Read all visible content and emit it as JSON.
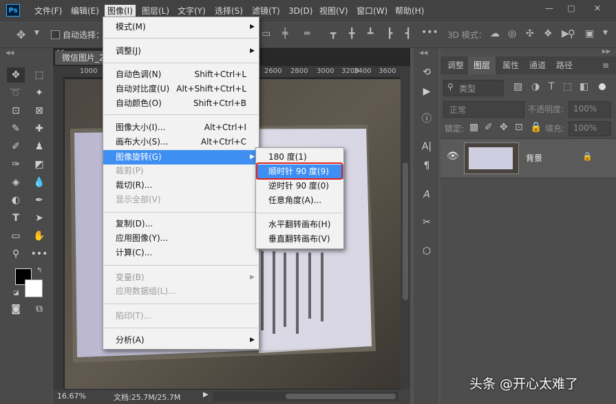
{
  "app": {
    "logo": "Ps"
  },
  "menubar": {
    "items": [
      "文件(F)",
      "编辑(E)",
      "图像(I)",
      "图层(L)",
      "文字(Y)",
      "选择(S)",
      "滤镜(T)",
      "3D(D)",
      "视图(V)",
      "窗口(W)",
      "帮助(H)"
    ],
    "active": "图像(I)",
    "window_controls": [
      "minimize-icon",
      "maximize-icon",
      "close-icon"
    ]
  },
  "options_bar": {
    "auto_select_label": "自动选择：",
    "mode3d_label": "3D 模式："
  },
  "document": {
    "tab_title": "微信图片_2",
    "ruler_ticks": [
      "1000",
      "2600",
      "2800",
      "3000",
      "3200",
      "3400",
      "3600"
    ],
    "zoom": "16.67%",
    "doc_size": "文档:25.7M/25.7M"
  },
  "panels": {
    "tabs": [
      "调整",
      "图层",
      "属性",
      "通道",
      "路径"
    ],
    "active_tab": "图层",
    "filter_label": "类型",
    "blend_mode": "正常",
    "opacity_label": "不透明度:",
    "opacity_value": "100%",
    "lock_label": "锁定:",
    "fill_label": "填充:",
    "fill_value": "100%",
    "layers": [
      {
        "name": "背景",
        "visible": true,
        "locked": true
      }
    ]
  },
  "image_menu": {
    "items": [
      {
        "label": "模式(M)",
        "shortcut": "",
        "submenu": true,
        "disabled": false
      },
      {
        "label": "调整(J)",
        "shortcut": "",
        "submenu": true,
        "disabled": false
      },
      {
        "label": "自动色调(N)",
        "shortcut": "Shift+Ctrl+L",
        "submenu": false,
        "disabled": false
      },
      {
        "label": "自动对比度(U)",
        "shortcut": "Alt+Shift+Ctrl+L",
        "submenu": false,
        "disabled": false
      },
      {
        "label": "自动颜色(O)",
        "shortcut": "Shift+Ctrl+B",
        "submenu": false,
        "disabled": false
      },
      {
        "label": "图像大小(I)...",
        "shortcut": "Alt+Ctrl+I",
        "submenu": false,
        "disabled": false
      },
      {
        "label": "画布大小(S)...",
        "shortcut": "Alt+Ctrl+C",
        "submenu": false,
        "disabled": false
      },
      {
        "label": "图像旋转(G)",
        "shortcut": "",
        "submenu": true,
        "disabled": false,
        "highlighted": true
      },
      {
        "label": "裁剪(P)",
        "shortcut": "",
        "submenu": false,
        "disabled": true
      },
      {
        "label": "裁切(R)...",
        "shortcut": "",
        "submenu": false,
        "disabled": false
      },
      {
        "label": "显示全部(V)",
        "shortcut": "",
        "submenu": false,
        "disabled": true
      },
      {
        "label": "复制(D)...",
        "shortcut": "",
        "submenu": false,
        "disabled": false
      },
      {
        "label": "应用图像(Y)...",
        "shortcut": "",
        "submenu": false,
        "disabled": false
      },
      {
        "label": "计算(C)...",
        "shortcut": "",
        "submenu": false,
        "disabled": false
      },
      {
        "label": "变量(B)",
        "shortcut": "",
        "submenu": true,
        "disabled": true
      },
      {
        "label": "应用数据组(L)...",
        "shortcut": "",
        "submenu": false,
        "disabled": true
      },
      {
        "label": "陷印(T)...",
        "shortcut": "",
        "submenu": false,
        "disabled": true
      },
      {
        "label": "分析(A)",
        "shortcut": "",
        "submenu": true,
        "disabled": false
      }
    ]
  },
  "rotate_submenu": {
    "items": [
      {
        "label": "180 度(1)",
        "highlighted": false
      },
      {
        "label": "顺时针 90 度(9)",
        "highlighted": true
      },
      {
        "label": "逆时针 90 度(0)",
        "highlighted": false
      },
      {
        "label": "任意角度(A)...",
        "highlighted": false
      },
      {
        "label": "水平翻转画布(H)",
        "highlighted": false
      },
      {
        "label": "垂直翻转画布(V)",
        "highlighted": false
      }
    ]
  },
  "watermark": "头条 @开心太难了",
  "colors": {
    "menu_highlight": "#3f8ff2",
    "annotation_box": "#e02020"
  }
}
